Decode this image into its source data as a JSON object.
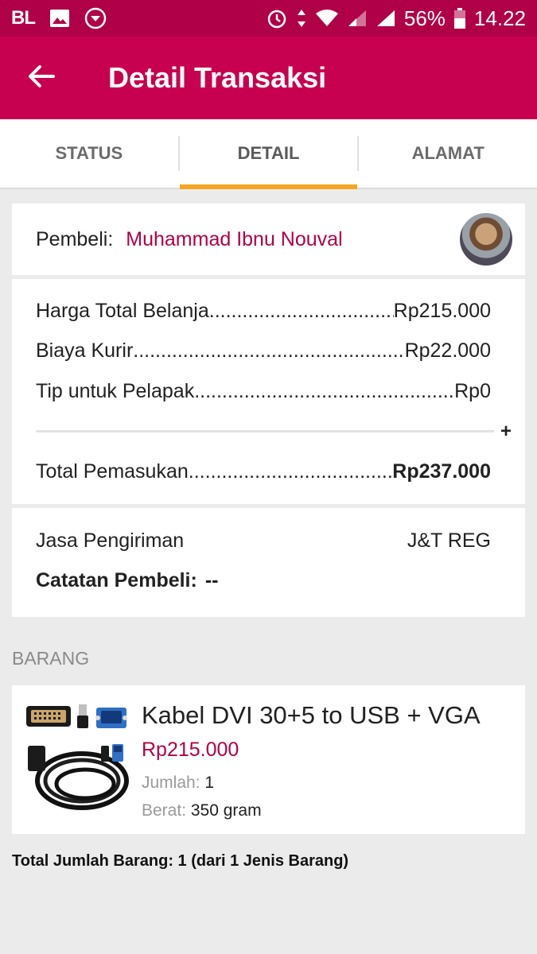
{
  "status_bar": {
    "carrier": "BL",
    "battery": "56%",
    "time": "14.22"
  },
  "app_bar": {
    "title": "Detail Transaksi"
  },
  "tabs": [
    {
      "label": "STATUS",
      "active": false
    },
    {
      "label": "DETAIL",
      "active": true
    },
    {
      "label": "ALAMAT",
      "active": false
    }
  ],
  "buyer": {
    "label": "Pembeli:",
    "name": "Muhammad Ibnu Nouval"
  },
  "summary": {
    "rows": [
      {
        "label": "Harga Total Belanja",
        "value": "Rp215.000"
      },
      {
        "label": "Biaya Kurir",
        "value": "Rp22.000"
      },
      {
        "label": "Tip untuk Pelapak",
        "value": "Rp0"
      }
    ],
    "plus": "+",
    "total_label": "Total Pemasukan",
    "total_value": "Rp237.000"
  },
  "shipping": {
    "service_label": "Jasa Pengiriman",
    "service_value": "J&T REG",
    "note_label": "Catatan Pembeli:",
    "note_value": "--"
  },
  "items_section": {
    "label": "BARANG",
    "items": [
      {
        "name": "Kabel DVI 30+5 to USB + VGA",
        "price": "Rp215.000",
        "qty_label": "Jumlah:",
        "qty_value": "1",
        "weight_label": "Berat:",
        "weight_value": "350 gram"
      }
    ]
  },
  "footer": {
    "total_items": "Total Jumlah Barang: 1 (dari 1 Jenis Barang)"
  },
  "colors": {
    "status_bar": "#b00048",
    "app_bar": "#c7004f",
    "accent_tab": "#f5a623",
    "buyer_name": "#b00048"
  }
}
